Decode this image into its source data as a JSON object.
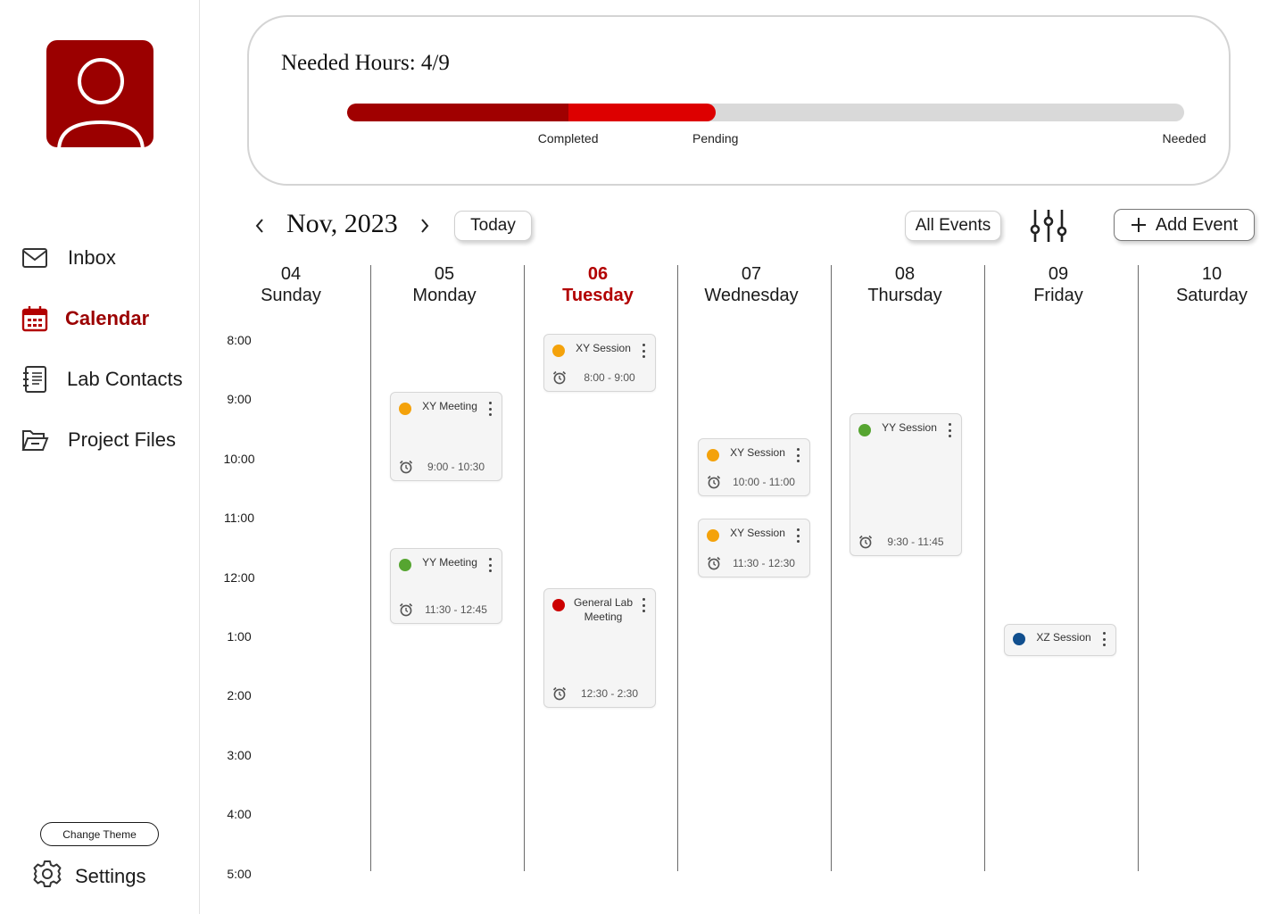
{
  "colors": {
    "brand": "#9b0000",
    "today": "#b20000",
    "completed": "#a00000",
    "pending": "#dd0000",
    "track": "#d9d9d9",
    "xy": "#f4a20b",
    "yy": "#56a531",
    "general": "#cc0000",
    "xz": "#114f8e"
  },
  "sidebar": {
    "avatar_icon": "user-icon",
    "nav": [
      {
        "label": "Inbox",
        "icon": "mail-icon",
        "active": false
      },
      {
        "label": "Calendar",
        "icon": "calendar-icon",
        "active": true
      },
      {
        "label": "Lab Contacts",
        "icon": "contacts-list-icon",
        "active": false
      },
      {
        "label": "Project Files",
        "icon": "folder-icon",
        "active": false
      }
    ],
    "theme_button": "Change Theme",
    "settings_label": "Settings"
  },
  "hours": {
    "title": "Needed Hours: 4/9",
    "completed_fraction": 0.264,
    "pending_fraction": 0.44,
    "labels": {
      "completed": "Completed",
      "pending": "Pending",
      "needed": "Needed"
    }
  },
  "toolbar": {
    "month": "Nov, 2023",
    "today_button": "Today",
    "all_events_button": "All Events",
    "filter_icon": "sliders-icon",
    "add_event_button": "Add Event"
  },
  "days": [
    {
      "date": "04",
      "name": "Sunday",
      "today": false
    },
    {
      "date": "05",
      "name": "Monday",
      "today": false
    },
    {
      "date": "06",
      "name": "Tuesday",
      "today": true
    },
    {
      "date": "07",
      "name": "Wednesday",
      "today": false
    },
    {
      "date": "08",
      "name": "Thursday",
      "today": false
    },
    {
      "date": "09",
      "name": "Friday",
      "today": false
    },
    {
      "date": "10",
      "name": "Saturday",
      "today": false
    }
  ],
  "times": [
    "8:00",
    "9:00",
    "10:00",
    "11:00",
    "12:00",
    "1:00",
    "2:00",
    "3:00",
    "4:00",
    "5:00"
  ],
  "events": [
    {
      "title": "XY Meeting",
      "time": "9:00 - 10:30",
      "day": 1,
      "color": "xy"
    },
    {
      "title": "YY Meeting",
      "time": "11:30 - 12:45",
      "day": 1,
      "color": "yy"
    },
    {
      "title": "XY Session",
      "time": "8:00 - 9:00",
      "day": 2,
      "color": "xy"
    },
    {
      "title": "General Lab Meeting",
      "time": "12:30 - 2:30",
      "day": 2,
      "color": "general"
    },
    {
      "title": "XY Session",
      "time": "10:00 - 11:00",
      "day": 3,
      "color": "xy"
    },
    {
      "title": "XY Session",
      "time": "11:30 - 12:30",
      "day": 3,
      "color": "xy"
    },
    {
      "title": "YY Session",
      "time": "9:30 - 11:45",
      "day": 4,
      "color": "yy"
    },
    {
      "title": "XZ Session",
      "time": "",
      "day": 5,
      "color": "xz"
    }
  ]
}
